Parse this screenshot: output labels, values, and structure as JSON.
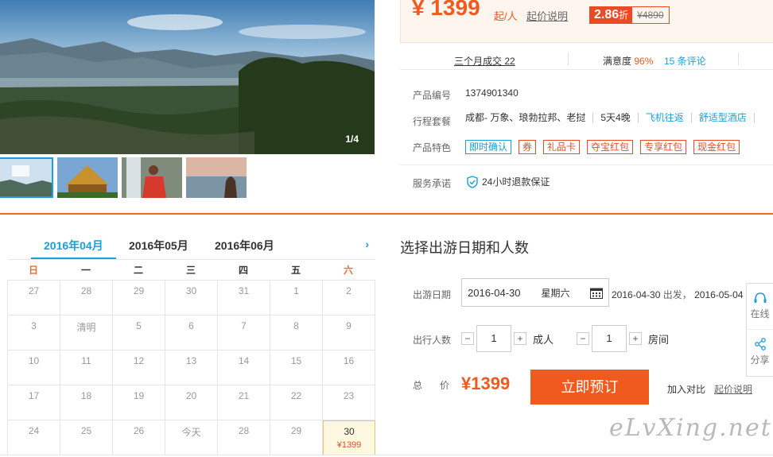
{
  "gallery": {
    "counter": "1/4",
    "thumbs": [
      "thumb-1",
      "thumb-2",
      "thumb-3",
      "thumb-4"
    ]
  },
  "price": {
    "amount": "¥ 1399",
    "from_label": "起/人",
    "explain": "起价说明",
    "discount": "2.86",
    "discount_unit": "折",
    "original": "¥4890"
  },
  "stats": {
    "sold": "三个月成交 22",
    "satisfaction_label": "满意度",
    "satisfaction_value": "96%",
    "reviews": "15 条评论"
  },
  "info": {
    "product_no_label": "产品编号",
    "product_no": "1374901340",
    "package_label": "行程套餐",
    "package_route": "成都- 万象、琅勃拉邦、老挝",
    "package_days": "5天4晚",
    "package_flight": "飞机往返",
    "package_hotel": "舒适型酒店",
    "features_label": "产品特色",
    "features": [
      "即时确认",
      "券",
      "礼品卡",
      "夺宝红包",
      "专享红包",
      "现金红包"
    ],
    "service_label": "服务承诺",
    "service": "24小时退款保证"
  },
  "calendar": {
    "months": [
      "2016年04月",
      "2016年05月",
      "2016年06月"
    ],
    "next": "›",
    "weekdays": [
      "日",
      "一",
      "二",
      "三",
      "四",
      "五",
      "六"
    ],
    "weeks": [
      [
        "27",
        "28",
        "29",
        "30",
        "31",
        "1",
        "2"
      ],
      [
        "3",
        "清明",
        "5",
        "6",
        "7",
        "8",
        "9"
      ],
      [
        "10",
        "11",
        "12",
        "13",
        "14",
        "15",
        "16"
      ],
      [
        "17",
        "18",
        "19",
        "20",
        "21",
        "22",
        "23"
      ],
      [
        "24",
        "25",
        "26",
        "今天",
        "28",
        "29",
        "30"
      ]
    ],
    "selected_price": "¥1399"
  },
  "booking": {
    "title": "选择出游日期和人数",
    "date_label": "出游日期",
    "date_value": "2016-04-30",
    "weekday": "星期六",
    "date_note_1": "2016-04-30",
    "date_note_2": "出发，",
    "date_note_3": "2016-05-04",
    "people_label": "出行人数",
    "adults": "1",
    "adults_unit": "成人",
    "rooms": "1",
    "rooms_unit": "房间",
    "minus": "−",
    "plus": "+",
    "total_label": "总价",
    "total_value": "¥1399",
    "book_button": "立即预订",
    "compare": "加入对比",
    "explain": "起价说明"
  },
  "float_bar": {
    "online": "在线",
    "share": "分享"
  },
  "watermark": "eLvXing.net",
  "colors": {
    "accent": "#f15a1f",
    "link": "#1ba0d8",
    "tag_red": "#e94b23"
  }
}
